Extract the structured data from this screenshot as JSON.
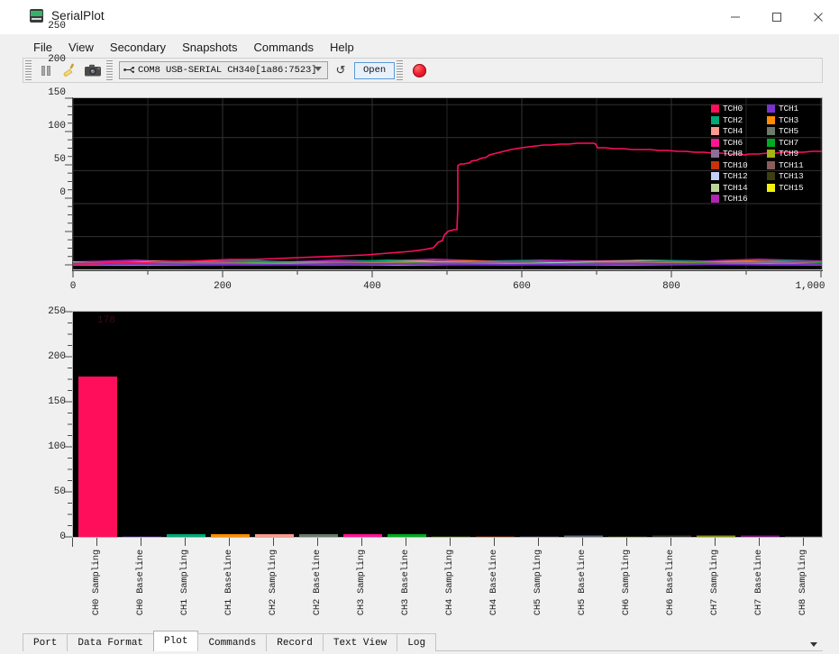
{
  "window": {
    "title": "SerialPlot",
    "icon": "serialplot-icon",
    "controls": [
      {
        "name": "minimize-button",
        "glyph": "minimize-icon"
      },
      {
        "name": "maximize-button",
        "glyph": "maximize-icon"
      },
      {
        "name": "close-button",
        "glyph": "close-icon"
      }
    ]
  },
  "menubar": {
    "items": [
      {
        "label": "File"
      },
      {
        "label": "View"
      },
      {
        "label": "Secondary"
      },
      {
        "label": "Snapshots"
      },
      {
        "label": "Commands"
      },
      {
        "label": "Help"
      }
    ]
  },
  "toolbar": {
    "pause_icon": "pause-icon",
    "clear_icon": "broom-clear-icon",
    "snapshot_icon": "camera-snapshot-icon",
    "port": {
      "value": "COM8 USB-SERIAL CH340[1a86:7523]",
      "usb_icon": "usb-icon",
      "arrow_icon": "chevron-down-icon"
    },
    "refresh_label": "↺",
    "open_label": "Open",
    "record_icon": "record-dot-icon"
  },
  "chart_data": [
    {
      "type": "line",
      "name": "time-series-plot",
      "title": "",
      "xlabel": "",
      "ylabel": "",
      "xlim": [
        0,
        1000
      ],
      "ylim": [
        0,
        250
      ],
      "xticks": [
        0,
        200,
        400,
        600,
        800,
        1000
      ],
      "xticklabels": [
        "0",
        "200",
        "400",
        "600",
        "800",
        "1,000"
      ],
      "yticks": [
        0,
        50,
        100,
        150,
        200,
        250
      ],
      "yticklabels": [
        "0",
        "50",
        "100",
        "150",
        "200",
        "250"
      ],
      "grid": true,
      "background": "#000000",
      "legend_position": "right-top",
      "legend": [
        {
          "label": "TCH0",
          "color": "#ff0f5b"
        },
        {
          "label": "TCH1",
          "color": "#7a33cc"
        },
        {
          "label": "TCH2",
          "color": "#00a878"
        },
        {
          "label": "TCH3",
          "color": "#ff8c00"
        },
        {
          "label": "TCH4",
          "color": "#fb9a8f"
        },
        {
          "label": "TCH5",
          "color": "#6b7a6b"
        },
        {
          "label": "TCH6",
          "color": "#ff1493"
        },
        {
          "label": "TCH7",
          "color": "#00aa22"
        },
        {
          "label": "TCH8",
          "color": "#8d6e96"
        },
        {
          "label": "TCH9",
          "color": "#a3b318"
        },
        {
          "label": "TCH10",
          "color": "#c8340a"
        },
        {
          "label": "TCH11",
          "color": "#8a5c5c"
        },
        {
          "label": "TCH12",
          "color": "#c2d0f5"
        },
        {
          "label": "TCH13",
          "color": "#3d3f12"
        },
        {
          "label": "TCH14",
          "color": "#bcd49a"
        },
        {
          "label": "TCH15",
          "color": "#f2f20d"
        },
        {
          "label": "TCH16",
          "color": "#b026b0"
        }
      ],
      "series": [
        {
          "name": "TCH0",
          "color": "#ff0f5b",
          "x": [
            0,
            30,
            60,
            90,
            120,
            150,
            180,
            210,
            240,
            270,
            300,
            330,
            360,
            390,
            420,
            450,
            470,
            480,
            490,
            495,
            500,
            505,
            508,
            512,
            516,
            520,
            525,
            530,
            540,
            550,
            560,
            575,
            590,
            600,
            615,
            630,
            645,
            660,
            675,
            690,
            705,
            720,
            740,
            760,
            780,
            800,
            820,
            840,
            860,
            880,
            900,
            920,
            940,
            960,
            980,
            1000
          ],
          "y": [
            2,
            2,
            3,
            2,
            3,
            3,
            2,
            3,
            3,
            3,
            4,
            4,
            5,
            5,
            6,
            8,
            10,
            13,
            16,
            20,
            46,
            48,
            52,
            120,
            128,
            150,
            154,
            166,
            170,
            176,
            180,
            184,
            186,
            187,
            188,
            187,
            188,
            187,
            186,
            180,
            179,
            178,
            178,
            177,
            177,
            176,
            175,
            175,
            176,
            176,
            177,
            177,
            178,
            178,
            178,
            178
          ]
        }
      ],
      "noise_series_note": "16 additional low-amplitude traces near baseline (values 0-8)"
    },
    {
      "type": "bar",
      "name": "channel-bar-plot",
      "title": "",
      "xlabel": "",
      "ylabel": "",
      "ylim": [
        0,
        250
      ],
      "yticks": [
        0,
        50,
        100,
        150,
        200,
        250
      ],
      "yticklabels": [
        "0",
        "50",
        "100",
        "150",
        "200",
        "250"
      ],
      "grid": false,
      "background": "#000000",
      "categories": [
        "CH0 Sampling",
        "CH0 Baseline",
        "CH1 Sampling",
        "CH1 Baseline",
        "CH2 Sampling",
        "CH2 Baseline",
        "CH3 Sampling",
        "CH3 Baseline",
        "CH4 Sampling",
        "CH4 Baseline",
        "CH5 Sampling",
        "CH5 Baseline",
        "CH6 Sampling",
        "CH6 Baseline",
        "CH7 Sampling",
        "CH7 Baseline",
        "CH8 Sampling"
      ],
      "values": [
        178,
        1,
        3,
        3,
        3,
        3,
        3,
        3,
        1,
        1,
        1,
        1,
        1,
        2,
        1,
        2,
        2
      ],
      "colors": [
        "#ff0f5b",
        "#2b1140",
        "#00a878",
        "#ff8c00",
        "#fb9a8f",
        "#6b7a6b",
        "#ff1493",
        "#00aa22",
        "#1b2a08",
        "#4a1505",
        "#2a2030",
        "#5a6a7a",
        "#1a2208",
        "#3a3a2a",
        "#8a8f12",
        "#7a1a7a",
        "#2a2a2a"
      ],
      "datalabels": [
        {
          "index": 0,
          "text": "178"
        }
      ]
    }
  ],
  "tabs": {
    "items": [
      {
        "label": "Port",
        "active": false
      },
      {
        "label": "Data Format",
        "active": false
      },
      {
        "label": "Plot",
        "active": true
      },
      {
        "label": "Commands",
        "active": false
      },
      {
        "label": "Record",
        "active": false
      },
      {
        "label": "Text View",
        "active": false
      },
      {
        "label": "Log",
        "active": false
      }
    ],
    "overflow_icon": "chevron-down-icon"
  }
}
